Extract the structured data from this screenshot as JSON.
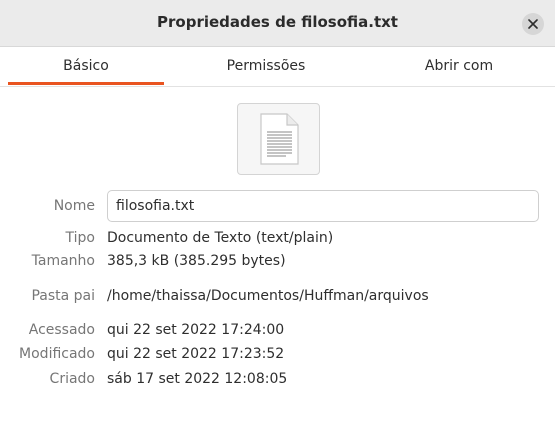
{
  "window": {
    "title": "Propriedades de filosofia.txt"
  },
  "tabs": [
    {
      "label": "Básico",
      "active": true
    },
    {
      "label": "Permissões",
      "active": false
    },
    {
      "label": "Abrir com",
      "active": false
    }
  ],
  "icons": {
    "close": "close-icon",
    "file": "text-file-icon"
  },
  "colors": {
    "accent": "#e95420",
    "titlebar": "#ebebeb",
    "label": "#767676"
  },
  "properties": {
    "name": {
      "label": "Nome",
      "value": "filosofia.txt"
    },
    "type": {
      "label": "Tipo",
      "value": "Documento de Texto (text/plain)"
    },
    "size": {
      "label": "Tamanho",
      "value": "385,3 kB (385.295 bytes)"
    },
    "parent": {
      "label": "Pasta pai",
      "value": "/home/thaissa/Documentos/Huffman/arquivos"
    },
    "accessed": {
      "label": "Acessado",
      "value": "qui 22 set 2022 17:24:00"
    },
    "modified": {
      "label": "Modificado",
      "value": "qui 22 set 2022 17:23:52"
    },
    "created": {
      "label": "Criado",
      "value": "sáb 17 set 2022 12:08:05"
    }
  }
}
